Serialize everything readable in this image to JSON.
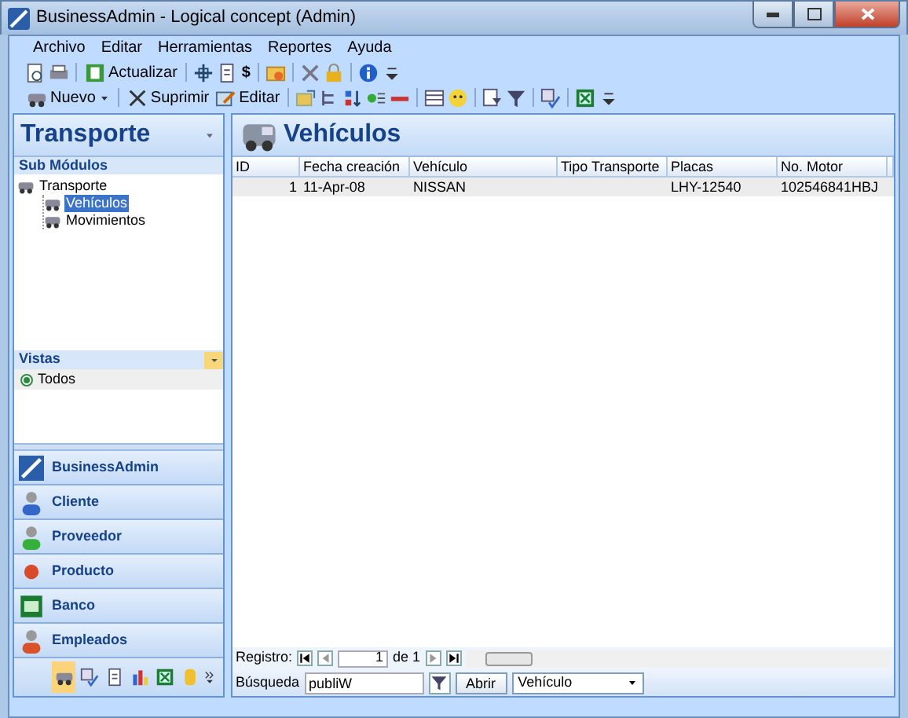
{
  "window": {
    "title": "BusinessAdmin - Logical concept (Admin)"
  },
  "menu": [
    "Archivo",
    "Editar",
    "Herramientas",
    "Reportes",
    "Ayuda"
  ],
  "toolbar_1": [
    {
      "kind": "icon"
    },
    {
      "kind": "icon"
    },
    {
      "kind": "sep"
    },
    {
      "kind": "button",
      "label": "Actualizar"
    },
    {
      "kind": "sep"
    },
    {
      "kind": "icon"
    },
    {
      "kind": "icon"
    },
    {
      "kind": "glyph",
      "label": "$"
    },
    {
      "kind": "sep"
    },
    {
      "kind": "icon"
    },
    {
      "kind": "sep"
    },
    {
      "kind": "icon"
    },
    {
      "kind": "icon"
    },
    {
      "kind": "sep"
    },
    {
      "kind": "icon"
    }
  ],
  "toolbar_2": [
    {
      "kind": "dropdown",
      "label": "Nuevo"
    },
    {
      "kind": "sep"
    },
    {
      "kind": "button",
      "label": "Suprimir"
    },
    {
      "kind": "button",
      "label": "Editar"
    },
    {
      "kind": "sep"
    },
    {
      "kind": "icon"
    },
    {
      "kind": "icon"
    },
    {
      "kind": "icon"
    },
    {
      "kind": "icon"
    },
    {
      "kind": "icon"
    },
    {
      "kind": "sep"
    },
    {
      "kind": "icon"
    },
    {
      "kind": "icon"
    },
    {
      "kind": "sep"
    },
    {
      "kind": "icon"
    },
    {
      "kind": "icon"
    },
    {
      "kind": "sep"
    },
    {
      "kind": "icon"
    },
    {
      "kind": "sep"
    },
    {
      "kind": "icon"
    }
  ],
  "sidebar": {
    "title": "Transporte",
    "section": "Sub Módulos",
    "tree": [
      {
        "label": "Transporte",
        "selected": false,
        "children": [
          {
            "label": "Vehículos",
            "selected": true
          },
          {
            "label": "Movimientos",
            "selected": false
          }
        ]
      }
    ],
    "views_title": "Vistas",
    "views": [
      {
        "label": "Todos",
        "selected": true
      }
    ],
    "modules": [
      "BusinessAdmin",
      "Cliente",
      "Proveedor",
      "Producto",
      "Banco",
      "Empleados"
    ],
    "shortcuts": [
      {
        "selected": true
      },
      {
        "selected": false
      },
      {
        "selected": false
      },
      {
        "selected": false
      },
      {
        "selected": false
      },
      {
        "selected": false
      }
    ]
  },
  "content": {
    "title": "Vehículos",
    "table": {
      "columns": [
        "ID",
        "Fecha creación",
        "Vehículo",
        "Tipo Transporte",
        "Placas",
        "No. Motor"
      ],
      "rows": [
        {
          "cells": [
            "1",
            "11-Apr-08",
            "NISSAN",
            null,
            "LHY-12540",
            "102546841HBJ"
          ],
          "selected": true
        }
      ]
    },
    "navigator": {
      "label": "Registro:",
      "value": "1",
      "total": "de 1"
    },
    "search": {
      "label": "Búsqueda",
      "value": "publiW",
      "button": "Abrir",
      "field": "Vehículo"
    }
  }
}
